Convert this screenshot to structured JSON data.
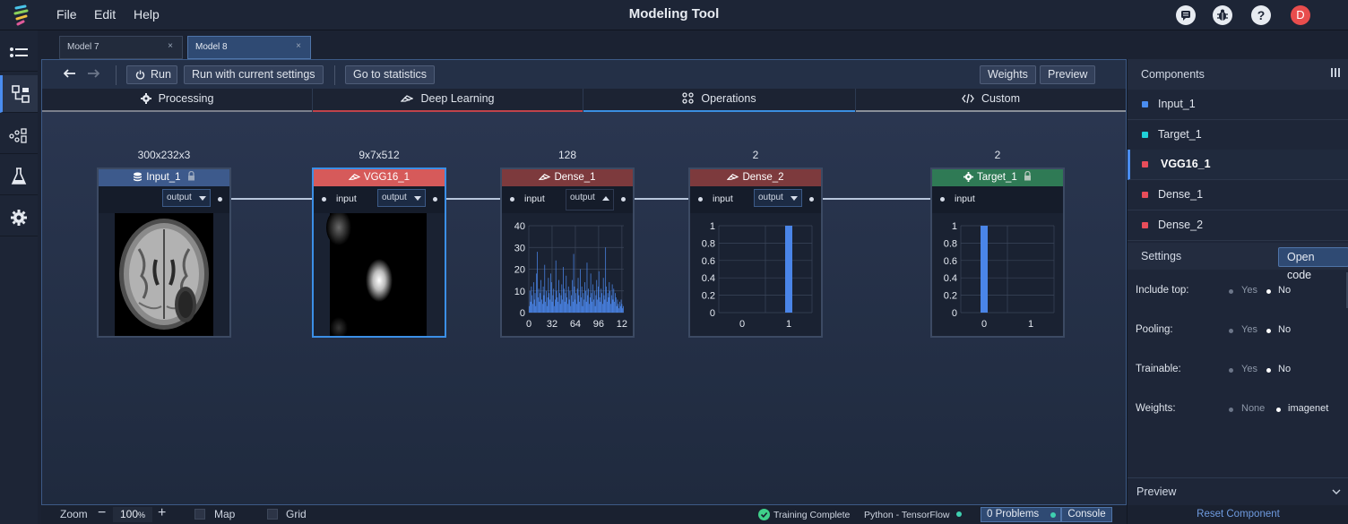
{
  "app": {
    "title": "Modeling Tool",
    "menu": [
      "File",
      "Edit",
      "Help"
    ],
    "user_initial": "D",
    "top_icons": [
      "chat-icon",
      "bug-icon",
      "help-icon"
    ]
  },
  "tabs": [
    {
      "label": "Model 7",
      "close": "×"
    },
    {
      "label": "Model 8",
      "close": "×"
    }
  ],
  "toolbar": {
    "run_label": "Run",
    "run_current_label": "Run with current settings",
    "stats_label": "Go to statistics",
    "weights_label": "Weights",
    "preview_label": "Preview"
  },
  "categories": [
    {
      "label": "Processing",
      "color": "#7a7f8c"
    },
    {
      "label": "Deep Learning",
      "color": "#c0434a"
    },
    {
      "label": "Operations",
      "color": "#3a8ee0"
    },
    {
      "label": "Custom",
      "color": "#8a8f99"
    }
  ],
  "nodes": {
    "input": {
      "dim": "300x232x3",
      "title": "Input_1",
      "output": "output",
      "color": "#3d5a8c"
    },
    "vgg": {
      "dim": "9x7x512",
      "title": "VGG16_1",
      "input": "input",
      "output": "output",
      "color": "#d65a5a"
    },
    "dense1": {
      "dim": "128",
      "title": "Dense_1",
      "input": "input",
      "output": "output",
      "color": "#7d3a3d"
    },
    "dense2": {
      "dim": "2",
      "title": "Dense_2",
      "input": "input",
      "output": "output",
      "color": "#7d3a3d"
    },
    "target": {
      "dim": "2",
      "title": "Target_1",
      "input": "input",
      "color": "#2f7a55"
    }
  },
  "chart_data": [
    {
      "type": "bar",
      "title": "Dense_1",
      "x_ticks": [
        "0",
        "32",
        "64",
        "96",
        "12"
      ],
      "y_ticks": [
        "0",
        "10",
        "20",
        "30",
        "40"
      ],
      "ylim": [
        0,
        40
      ],
      "values": [
        3,
        10,
        5,
        12,
        8,
        4,
        14,
        6,
        9,
        3,
        18,
        28,
        7,
        11,
        5,
        9,
        15,
        6,
        4,
        12,
        8,
        22,
        5,
        10,
        3,
        7,
        16,
        9,
        6,
        18,
        14,
        5,
        8,
        11,
        3,
        6,
        24,
        10,
        7,
        5,
        15,
        9,
        4,
        8,
        13,
        6,
        21,
        11,
        5,
        9,
        17,
        7,
        4,
        12,
        6,
        10,
        3,
        8,
        15,
        5,
        27,
        12,
        6,
        9,
        4,
        11,
        16,
        8,
        5,
        20,
        7,
        12,
        3,
        9,
        6,
        14,
        10,
        5,
        23,
        8,
        11,
        4,
        7,
        18,
        9,
        5,
        13,
        6,
        10,
        3,
        8,
        15,
        6,
        12,
        19,
        7,
        5,
        11,
        9,
        4,
        16,
        8,
        6,
        30,
        12,
        5,
        9,
        7,
        14,
        10,
        4,
        8,
        13,
        6,
        11,
        5,
        9,
        7,
        3,
        6,
        4,
        2,
        5,
        3,
        6,
        4,
        2,
        3
      ]
    },
    {
      "type": "bar",
      "title": "Dense_2",
      "categories": [
        "0",
        "1"
      ],
      "values": [
        0,
        1
      ],
      "y_ticks": [
        "0",
        "0.2",
        "0.4",
        "0.6",
        "0.8",
        "1"
      ],
      "ylim": [
        0,
        1
      ]
    },
    {
      "type": "bar",
      "title": "Target_1",
      "categories": [
        "0",
        "1"
      ],
      "values": [
        1,
        0
      ],
      "y_ticks": [
        "0",
        "0.2",
        "0.4",
        "0.6",
        "0.8",
        "1"
      ],
      "ylim": [
        0,
        1
      ]
    }
  ],
  "components": {
    "header": "Components",
    "items": [
      {
        "label": "Input_1",
        "color": "#4a8df0"
      },
      {
        "label": "Target_1",
        "color": "#20d0d8"
      },
      {
        "label": "VGG16_1",
        "color": "#e84d5a"
      },
      {
        "label": "Dense_1",
        "color": "#e84d5a"
      },
      {
        "label": "Dense_2",
        "color": "#e84d5a"
      }
    ]
  },
  "settings": {
    "header": "Settings",
    "open_code_label": "Open code",
    "rows": [
      {
        "label": "Include top:",
        "opt1": "Yes",
        "opt2": "No"
      },
      {
        "label": "Pooling:",
        "opt1": "Yes",
        "opt2": "No"
      },
      {
        "label": "Trainable:",
        "opt1": "Yes",
        "opt2": "No"
      },
      {
        "label": "Weights:",
        "opt1": "None",
        "opt2": "imagenet"
      }
    ]
  },
  "preview": {
    "label": "Preview",
    "reset_label": "Reset Component"
  },
  "status": {
    "zoom_label": "Zoom",
    "zoom_minus": "−",
    "zoom_value": "100",
    "zoom_unit": "%",
    "zoom_plus": "+",
    "map_label": "Map",
    "grid_label": "Grid",
    "training": "Training Complete",
    "backend": "Python - TensorFlow",
    "problems": "0 Problems",
    "console": "Console"
  }
}
